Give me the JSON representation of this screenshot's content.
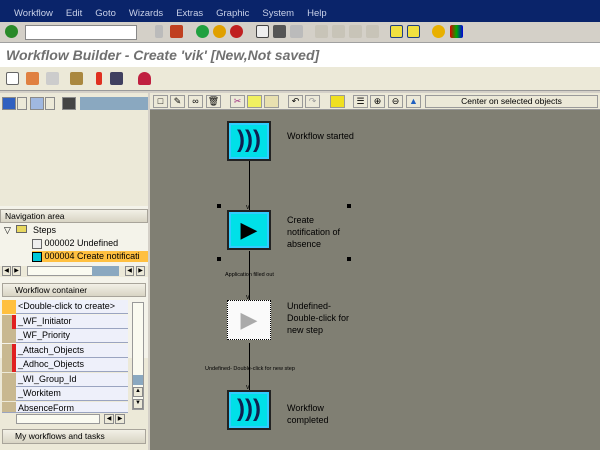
{
  "menu": [
    "Workflow",
    "Edit",
    "Goto",
    "Wizards",
    "Extras",
    "Graphic",
    "System",
    "Help"
  ],
  "page_title": "Workflow Builder - Create 'vik' [New,Not saved]",
  "canvas_toolbar": {
    "center_button": "Center on selected objects"
  },
  "navigation": {
    "header": "Navigation area",
    "root": "Steps",
    "items": [
      {
        "label": "000002 Undefined",
        "selected": false
      },
      {
        "label": "000004 Create notificati",
        "selected": true
      }
    ]
  },
  "container": {
    "header": "Workflow container",
    "rows": [
      "<Double-click to create>",
      "_WF_Initiator",
      "_WF_Priority",
      "_Attach_Objects",
      "_Adhoc_Objects",
      "_WI_Group_Id",
      "_Workitem",
      "AbsenceForm"
    ]
  },
  "footer_tab": "My workflows and tasks",
  "diagram": {
    "nodes": [
      {
        "text": "Workflow started",
        "icon": "event-icon"
      },
      {
        "text": "Create notification of absence",
        "icon": "activity-icon"
      },
      {
        "text": "Undefined- Double-click for new step",
        "icon": "undefined-step-icon"
      },
      {
        "text": "Workflow completed",
        "icon": "event-icon"
      }
    ],
    "edge_labels": [
      "Application filled out",
      "Undefined- Double-click for new step"
    ]
  },
  "colors": {
    "menubar": "#0a246a",
    "canvas": "#807f73",
    "node": "#00e0e8",
    "selected": "#ffc040"
  }
}
